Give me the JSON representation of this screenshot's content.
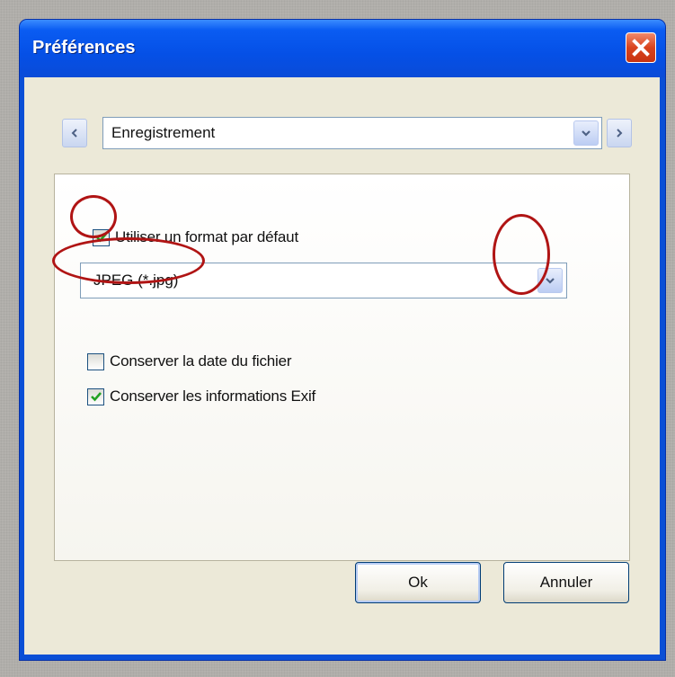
{
  "window": {
    "title": "Préférences",
    "close_icon": "close-x-icon"
  },
  "nav": {
    "prev_icon": "chevron-left-icon",
    "next_icon": "chevron-right-icon",
    "section_value": "Enregistrement",
    "dropdown_icon": "chevron-down-icon"
  },
  "options": {
    "default_format": {
      "label": "Utiliser un format par défaut",
      "checked": true
    },
    "format_select_value": "JPEG (*.jpg)",
    "keep_date": {
      "label": "Conserver la date du fichier",
      "checked": false
    },
    "keep_exif": {
      "label": "Conserver les informations Exif",
      "checked": true
    }
  },
  "buttons": {
    "ok_label": "Ok",
    "cancel_label": "Annuler"
  },
  "colors": {
    "titlebar": "#0550e6",
    "dialog_bg": "#ece9d8",
    "check_green": "#21a121",
    "annotation_red": "#b01414"
  }
}
